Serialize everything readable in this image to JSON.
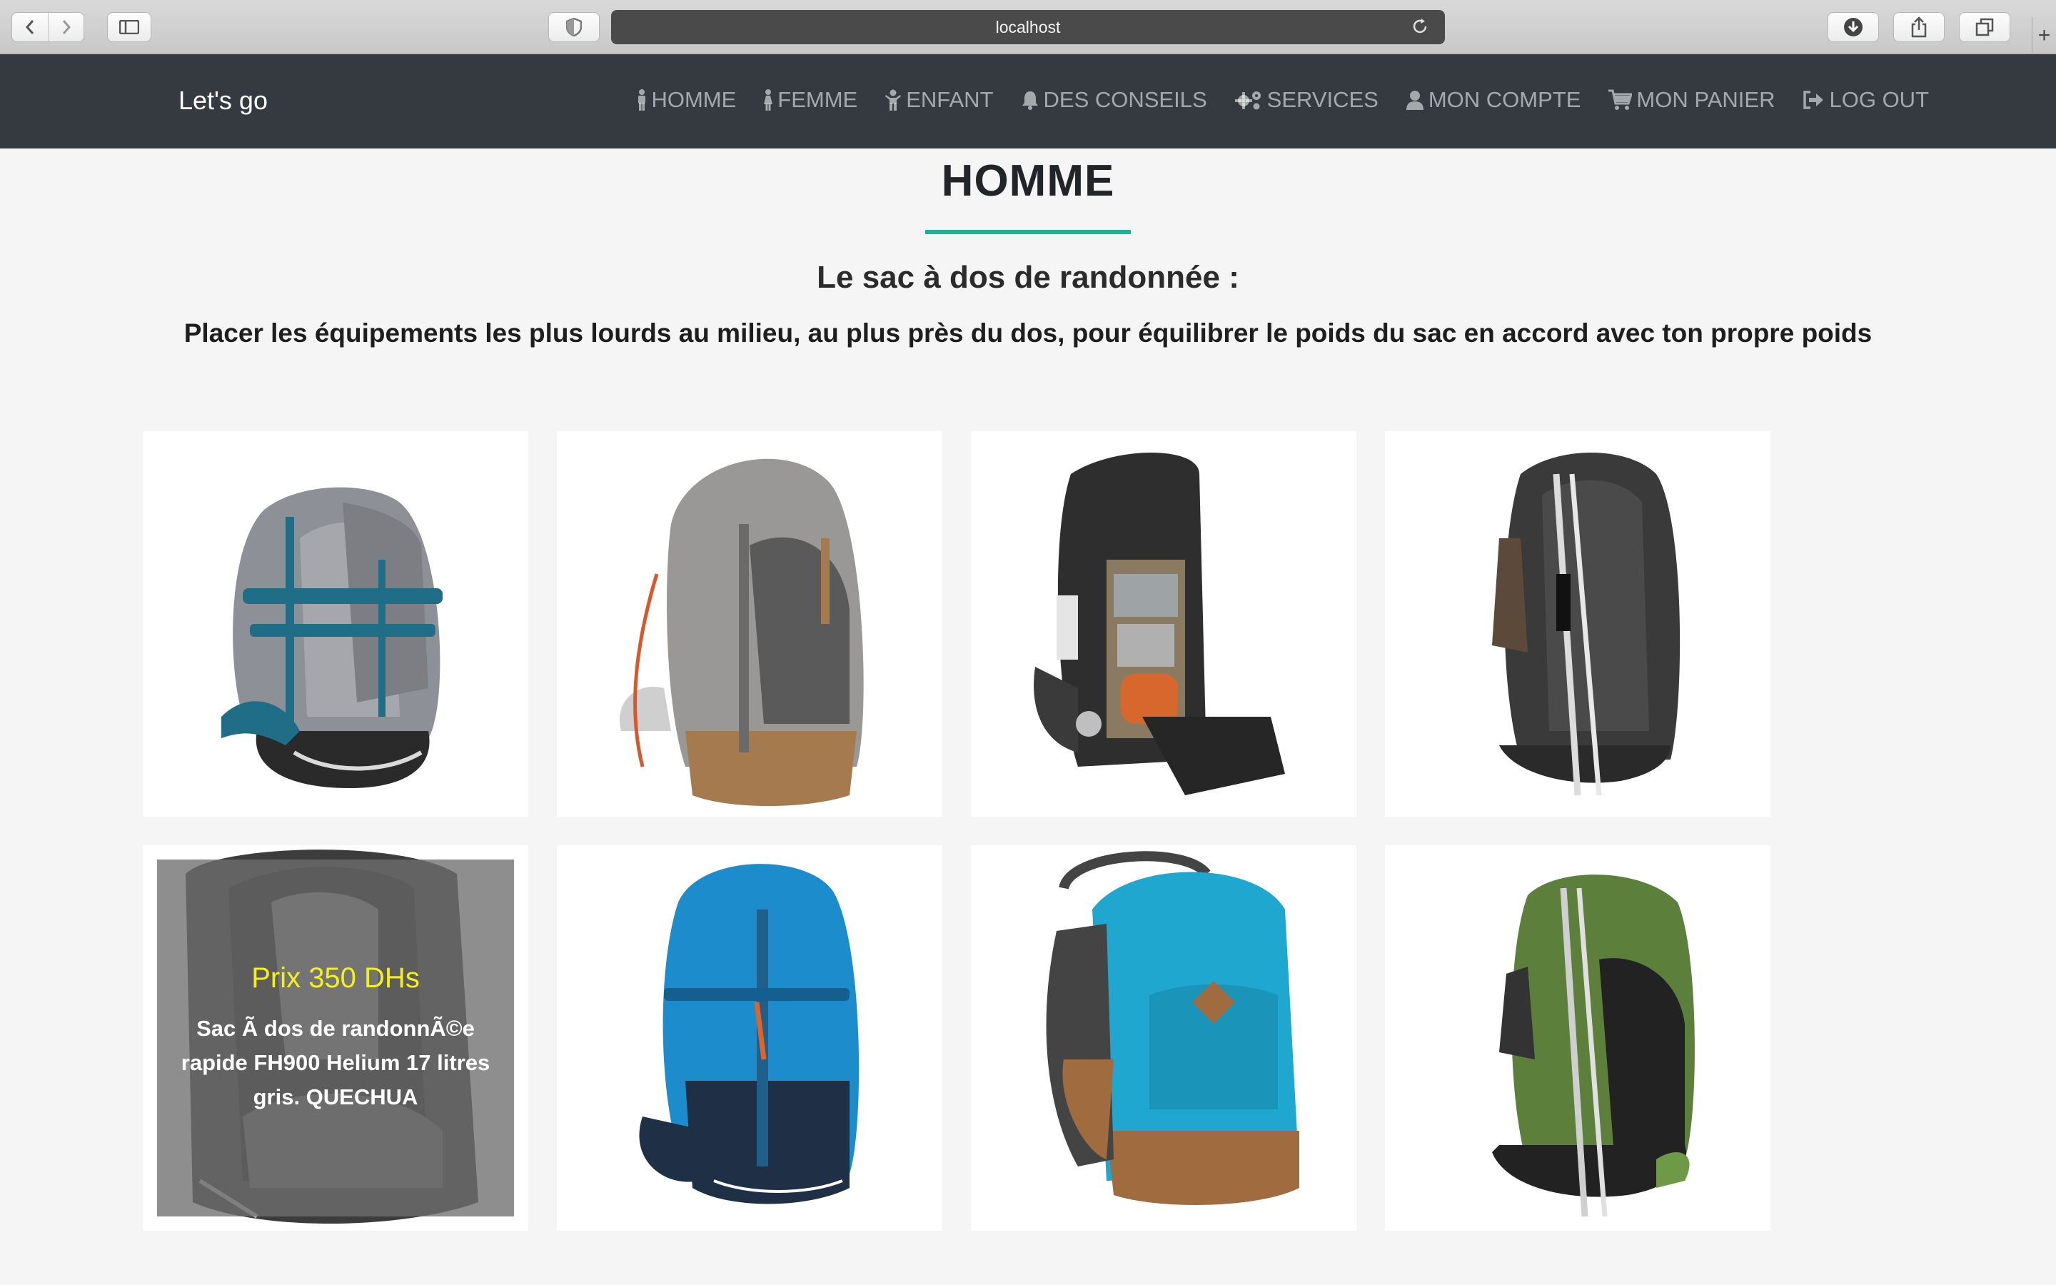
{
  "browser": {
    "url": "localhost"
  },
  "navbar": {
    "brand": "Let's go",
    "items": [
      {
        "label": "HOMME",
        "icon": "male-icon"
      },
      {
        "label": "FEMME",
        "icon": "female-icon"
      },
      {
        "label": "ENFANT",
        "icon": "child-icon"
      },
      {
        "label": "DES CONSEILS",
        "icon": "bell-icon"
      },
      {
        "label": "SERVICES",
        "icon": "gears-icon"
      },
      {
        "label": "MON COMPTE",
        "icon": "user-icon"
      },
      {
        "label": "MON PANIER",
        "icon": "cart-icon"
      },
      {
        "label": "LOG OUT",
        "icon": "sign-out-icon"
      }
    ]
  },
  "page": {
    "title": "HOMME",
    "subtitle": "Le sac à dos de randonnée :",
    "tip": "Placer les équipements les plus lourds au milieu, au plus près du dos, pour équilibrer le poids du sac en accord avec ton propre poids"
  },
  "products": [
    {
      "name": "backpack-grey-blue",
      "colors": [
        "#8e9097",
        "#1f6d86",
        "#2a2a2a"
      ]
    },
    {
      "name": "backpack-grey-tan",
      "colors": [
        "#9a9896",
        "#a47a4e",
        "#5a5a5a"
      ]
    },
    {
      "name": "backpack-black-open",
      "colors": [
        "#2e2e2e",
        "#d8672e",
        "#8a7a62"
      ]
    },
    {
      "name": "backpack-dark-grey",
      "colors": [
        "#3a3a3a",
        "#5b4a3a",
        "#dcdcdc"
      ]
    },
    {
      "name": "backpack-helium-grey",
      "colors": [
        "#3c3c3c",
        "#8a8a8a",
        "#1e1e1e"
      ],
      "hover": {
        "price": "Prix 350 DHs",
        "description": "Sac Ã dos de randonnÃ©e rapide FH900 Helium 17 litres gris. QUECHUA"
      }
    },
    {
      "name": "backpack-blue",
      "colors": [
        "#1d8ccc",
        "#1f2f45",
        "#e0632a"
      ]
    },
    {
      "name": "backpack-turquoise",
      "colors": [
        "#1fa7cf",
        "#a06b3e",
        "#444"
      ]
    },
    {
      "name": "backpack-green",
      "colors": [
        "#5c7f3c",
        "#222",
        "#cfcfcf"
      ]
    }
  ],
  "colors": {
    "navbar_bg": "#343a40",
    "accent_rule": "#17b592",
    "price": "#f4f01a"
  }
}
